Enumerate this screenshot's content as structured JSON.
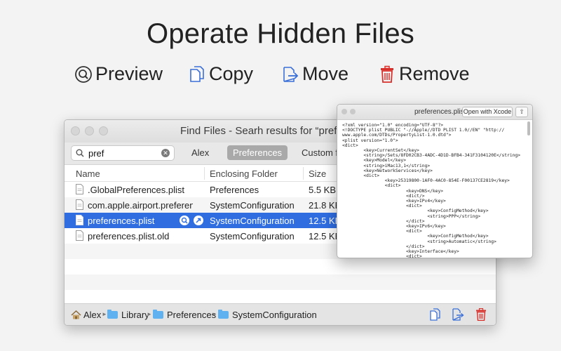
{
  "headline": "Operate Hidden Files",
  "features": [
    {
      "label": "Preview",
      "icon": "magnifier-circle-icon"
    },
    {
      "label": "Copy",
      "icon": "copy-icon"
    },
    {
      "label": "Move",
      "icon": "move-icon"
    },
    {
      "label": "Remove",
      "icon": "trash-icon"
    }
  ],
  "finder": {
    "title": "Find Files - Searh results for “pref”,",
    "search_value": "pref",
    "scopes": [
      "Alex",
      "Preferences",
      "Custom fo"
    ],
    "selected_scope": "Preferences",
    "columns": [
      "Name",
      "Enclosing Folder",
      "Size"
    ],
    "rows": [
      {
        "name": ".GlobalPreferences.plist",
        "folder": "Preferences",
        "size": "5.5 KB"
      },
      {
        "name": "com.apple.airport.preferenc...",
        "folder": "SystemConfiguration",
        "size": "21.8 KB"
      },
      {
        "name": "preferences.plist",
        "folder": "SystemConfiguration",
        "size": "12.5 KB"
      },
      {
        "name": "preferences.plist.old",
        "folder": "SystemConfiguration",
        "size": "12.5 KB"
      }
    ],
    "selected_row": 2,
    "path": [
      "Alex",
      "Library",
      "Preferences",
      "SystemConfiguration"
    ]
  },
  "preview": {
    "filename": "preferences.plist",
    "open_button": "Open with Xcode",
    "lines": [
      "<?xml version=\"1.0\" encoding=\"UTF-8\"?>",
      "<!DOCTYPE plist PUBLIC \"-//Apple//DTD PLIST 1.0//EN\" \"http://",
      "www.apple.com/DTDs/PropertyList-1.0.dtd\">",
      "<plist version=\"1.0\">",
      "<dict>",
      "        <key>CurrentSet</key>",
      "        <string>/Sets/8FD02CB3-4ADC-4D1D-BFB4-341F3104120E</string>",
      "        <key>Model</key>",
      "        <string>iMac13,1</string>",
      "        <key>NetworkServices</key>",
      "        <dict>",
      "                <key>25319800-1AF0-4AC0-854E-F00137CE2819</key>",
      "                <dict>",
      "                        <key>DNS</key>",
      "                        <dict/>",
      "                        <key>IPv4</key>",
      "                        <dict>",
      "                                <key>ConfigMethod</key>",
      "                                <string>PPP</string>",
      "                        </dict>",
      "                        <key>IPv6</key>",
      "                        <dict>",
      "                                <key>ConfigMethod</key>",
      "                                <string>Automatic</string>",
      "                        </dict>",
      "                        <key>Interface</key>",
      "                        <dict>"
    ]
  },
  "colors": {
    "selection": "#2f6de1",
    "accent_blue": "#3a6fd8",
    "remove_red": "#d9302c",
    "folder_blue": "#5fb2ef"
  }
}
